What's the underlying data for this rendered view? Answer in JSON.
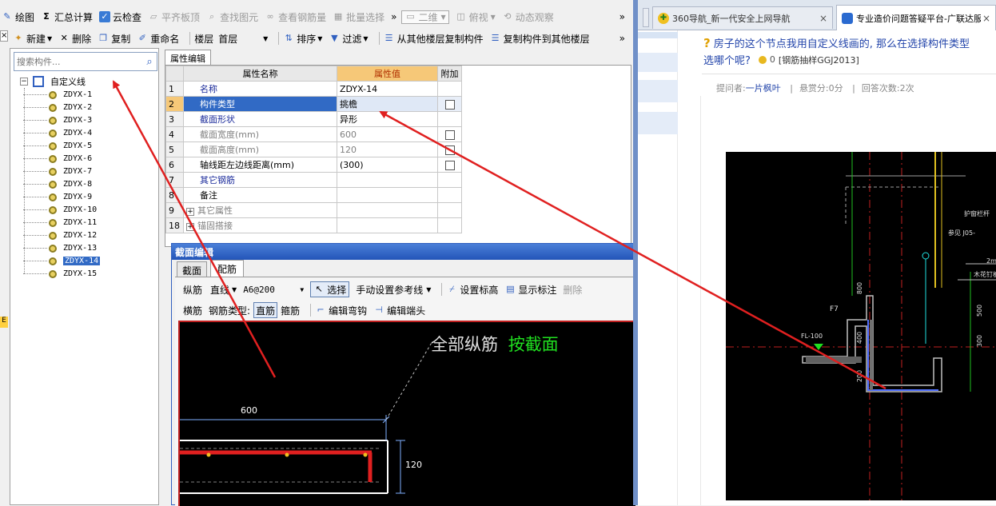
{
  "toolbar1": {
    "draw": "绘图",
    "summary": "汇总计算",
    "cloud_check": "云检查",
    "level_slab": "平齐板顶",
    "find_element": "查找图元",
    "view_rebar": "查看钢筋量",
    "batch_select": "批量选择",
    "more": "»",
    "view_mode": "二维",
    "top_view": "俯视",
    "dynamic_view": "动态观察",
    "more2": "»"
  },
  "toolbar2": {
    "new": "新建",
    "delete": "删除",
    "copy": "复制",
    "rename": "重命名",
    "floor_label": "楼层",
    "floor_value": "首层",
    "sort": "排序",
    "filter": "过滤",
    "copy_from_other": "从其他楼层复制构件",
    "copy_to_other": "复制构件到其他楼层",
    "more": "»"
  },
  "search": {
    "placeholder": "搜索构件..."
  },
  "tree": {
    "root": "自定义线",
    "items": [
      "ZDYX-1",
      "ZDYX-2",
      "ZDYX-3",
      "ZDYX-4",
      "ZDYX-5",
      "ZDYX-6",
      "ZDYX-7",
      "ZDYX-8",
      "ZDYX-9",
      "ZDYX-10",
      "ZDYX-11",
      "ZDYX-12",
      "ZDYX-13",
      "ZDYX-14",
      "ZDYX-15"
    ],
    "selected": "ZDYX-14"
  },
  "prop_tab": "属性编辑",
  "prop_headers": {
    "name": "属性名称",
    "value": "属性值",
    "extra": "附加"
  },
  "props": [
    {
      "no": "1",
      "name": "名称",
      "value": "ZDYX-14"
    },
    {
      "no": "2",
      "name": "构件类型",
      "value": "挑檐"
    },
    {
      "no": "3",
      "name": "截面形状",
      "value": "异形"
    },
    {
      "no": "4",
      "name": "截面宽度(mm)",
      "value": "600"
    },
    {
      "no": "5",
      "name": "截面高度(mm)",
      "value": "120"
    },
    {
      "no": "6",
      "name": "轴线距左边线距离(mm)",
      "value": "(300)"
    },
    {
      "no": "7",
      "name": "其它钢筋",
      "value": ""
    },
    {
      "no": "8",
      "name": "备注",
      "value": ""
    },
    {
      "no": "9",
      "name": "其它属性",
      "value": ""
    },
    {
      "no": "18",
      "name": "锚固搭接",
      "value": ""
    }
  ],
  "section_editor": {
    "title": "截面编辑",
    "tab_section": "截面",
    "tab_rebar": "配筋",
    "longitudinal": "纵筋",
    "line_mode": "直线",
    "rebar_spec": "A6@200",
    "select": "选择",
    "manual_ref": "手动设置参考线",
    "set_elevation": "设置标高",
    "show_label": "显示标注",
    "delete": "删除",
    "transverse": "横筋",
    "rebar_type_label": "钢筋类型:",
    "straight": "直筋",
    "stirrup": "箍筋",
    "edit_hook": "编辑弯钩",
    "edit_end": "编辑端头",
    "canvas_text_white": "全部纵筋",
    "canvas_text_green": "按截面",
    "dim_width": "600",
    "dim_height": "120"
  },
  "browser": {
    "tab1": "360导航_新一代安全上网导航",
    "tab2": "专业造价问题答疑平台-广联达服",
    "question_line1": "房子的这个节点我用自定义线画的, 那么在选择构件类型",
    "question_line2": "选哪个呢?",
    "reward_count": "0",
    "category": "[钢筋抽样GGJ2013]",
    "asker_label": "提问者:",
    "asker_name": "一片枫叶",
    "reward_label": "悬赏分:0分",
    "answer_label": "回答次数:2次"
  },
  "cad": {
    "level_label": "FL-100",
    "f7": "F7",
    "d800": "800",
    "d400": "400",
    "d200": "200",
    "d500": "500",
    "d300": "300",
    "note1": "护窗栏杆",
    "note2": "参见 J05-",
    "note3": "木花钉板",
    "note4": "2m"
  },
  "left_edge_label": "E",
  "colors": {
    "accent": "#316ac5",
    "cad_bg": "#000000",
    "rebar": "#e02020",
    "arrow": "#e02020"
  }
}
